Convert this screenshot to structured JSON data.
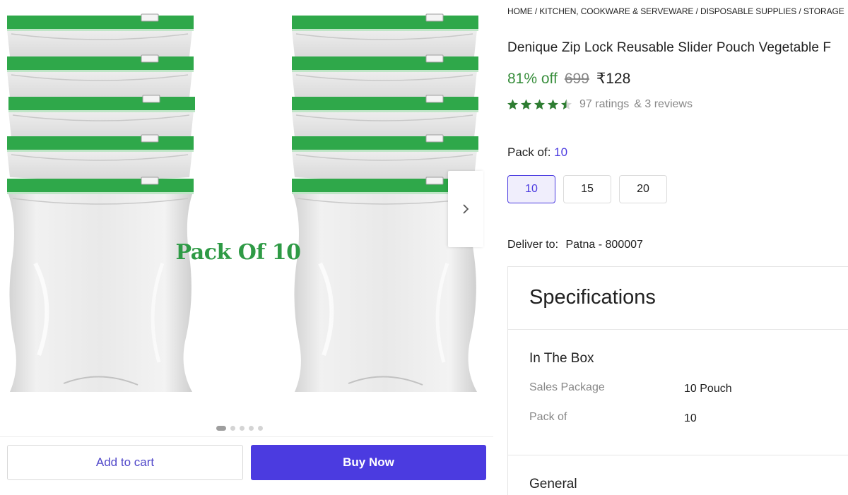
{
  "gallery": {
    "image_caption": "Pack Of 10",
    "dots_total": 5,
    "dots_active_index": 0,
    "add_to_cart_label": "Add to cart",
    "buy_now_label": "Buy Now"
  },
  "product": {
    "breadcrumb": "HOME / KITCHEN, COOKWARE & SERVEWARE / DISPOSABLE SUPPLIES / STORAGE",
    "title": "Denique Zip Lock Reusable Slider Pouch Vegetable F",
    "discount": "81% off",
    "mrp": "699",
    "price": "₹128",
    "rating_value": 4.5,
    "ratings_text": "97 ratings",
    "reviews_text": "& 3 reviews",
    "pack_label": "Pack of:",
    "pack_value": "10",
    "pack_options": [
      "10",
      "15",
      "20"
    ],
    "selected_pack": "10",
    "deliver_label": "Deliver to:",
    "deliver_location": "Patna - 800007"
  },
  "specifications": {
    "title": "Specifications",
    "groups": [
      {
        "name": "In The Box",
        "rows": [
          {
            "key": "Sales Package",
            "value": "10 Pouch"
          },
          {
            "key": "Pack of",
            "value": "10"
          }
        ]
      }
    ],
    "next_group": "General"
  },
  "colors": {
    "accent": "#4b3be0",
    "discount_green": "#388e3c",
    "star_green": "#2e7d32",
    "zip_green": "#2fa84a"
  },
  "icons": {
    "next_arrow": "chevron-right-icon",
    "star": "star-icon"
  }
}
